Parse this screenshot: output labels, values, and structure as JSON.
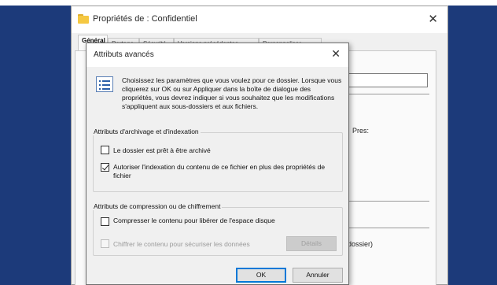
{
  "properties_window": {
    "title": "Propriétés de : Confidentiel",
    "close_glyph": "✕",
    "icon": "folder-icon",
    "tabs": [
      "Général",
      "Partage",
      "Sécurité",
      "Versions précédentes",
      "Personnaliser"
    ],
    "bg_text_right_1": "Pres:",
    "bg_text_right_2": "dossier)"
  },
  "dialog": {
    "title": "Attributs avancés",
    "close_glyph": "✕",
    "icon": "properties-icon",
    "description": "Choisissez les paramètres que vous voulez pour ce dossier. Lorsque vous cliquerez sur OK ou sur Appliquer dans la boîte de dialogue des propriétés, vous devrez indiquer si vous souhaitez que les modifications s'appliquent aux sous-dossiers et aux fichiers.",
    "archive_group": {
      "legend": "Attributs d'archivage et d'indexation",
      "archive_label": "Le dossier est prêt à être archivé",
      "archive_checked": false,
      "index_label": "Autoriser l'indexation du contenu de ce fichier en plus des propriétés de fichier",
      "index_checked": true
    },
    "compress_group": {
      "legend": "Attributs de compression ou de chiffrement",
      "compress_label": "Compresser le contenu pour libérer de l'espace disque",
      "compress_checked": false,
      "encrypt_label": "Chiffrer le contenu pour sécuriser les données",
      "encrypt_checked": false,
      "details_label": "Détails"
    },
    "ok_label": "OK",
    "cancel_label": "Annuler"
  }
}
